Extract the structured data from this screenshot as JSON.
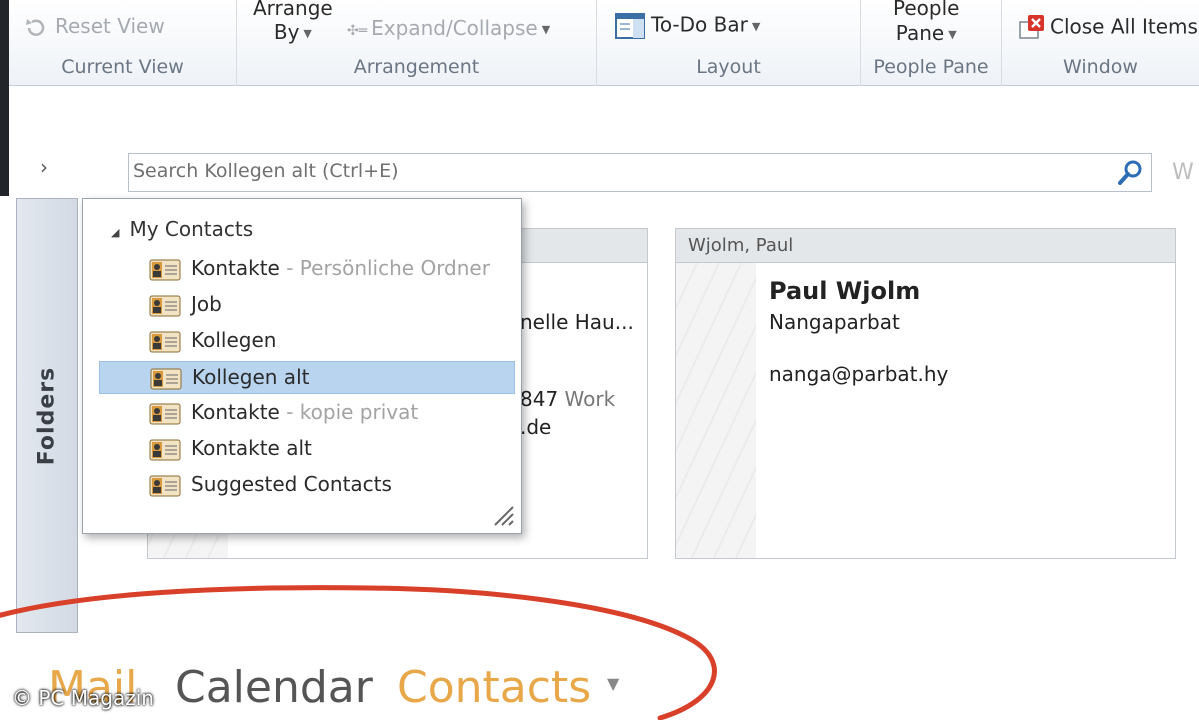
{
  "ribbon": {
    "reset_view": "Reset View",
    "current_view_label": "Current View",
    "arrange_by_line1": "Arrange",
    "arrange_by_line2": "By",
    "expand_collapse": "Expand/Collapse",
    "arrangement_label": "Arrangement",
    "todo_bar": "To-Do Bar",
    "layout_label": "Layout",
    "people_pane_line1": "People",
    "people_pane_line2": "Pane",
    "people_pane_label": "People Pane",
    "close_all_items": "Close All Items",
    "window_label": "Window"
  },
  "search": {
    "placeholder": "Search Kollegen alt (Ctrl+E)",
    "cut_text": "W"
  },
  "folders_pane": {
    "label": "Folders"
  },
  "dropdown": {
    "header": "My Contacts",
    "items": [
      {
        "label": "Kontakte",
        "sub": " - Persönliche Ordner",
        "selected": false
      },
      {
        "label": "Job",
        "sub": "",
        "selected": false
      },
      {
        "label": "Kollegen",
        "sub": "",
        "selected": false
      },
      {
        "label": "Kollegen alt",
        "sub": "",
        "selected": true
      },
      {
        "label": "Kontakte",
        "sub": " - kopie privat",
        "selected": false
      },
      {
        "label": "Kontakte alt",
        "sub": "",
        "selected": false
      },
      {
        "label": "Suggested Contacts",
        "sub": "",
        "selected": false
      }
    ]
  },
  "card1": {
    "partial_line1": "nelle Hau...",
    "partial_phone": "847",
    "partial_phone_type": "Work",
    "partial_email": ".de"
  },
  "card2": {
    "header": "Wjolm, Paul",
    "name": "Paul Wjolm",
    "company": "Nangaparbat",
    "email": "nanga@parbat.hy"
  },
  "nav": {
    "mail": "Mail",
    "calendar": "Calendar",
    "contacts": "Contacts"
  },
  "copyright": "© PC Magazin",
  "colors": {
    "accent_orange": "#e8a84a",
    "selection_blue": "#b8d4ee",
    "annotation_red": "#d9402a"
  }
}
